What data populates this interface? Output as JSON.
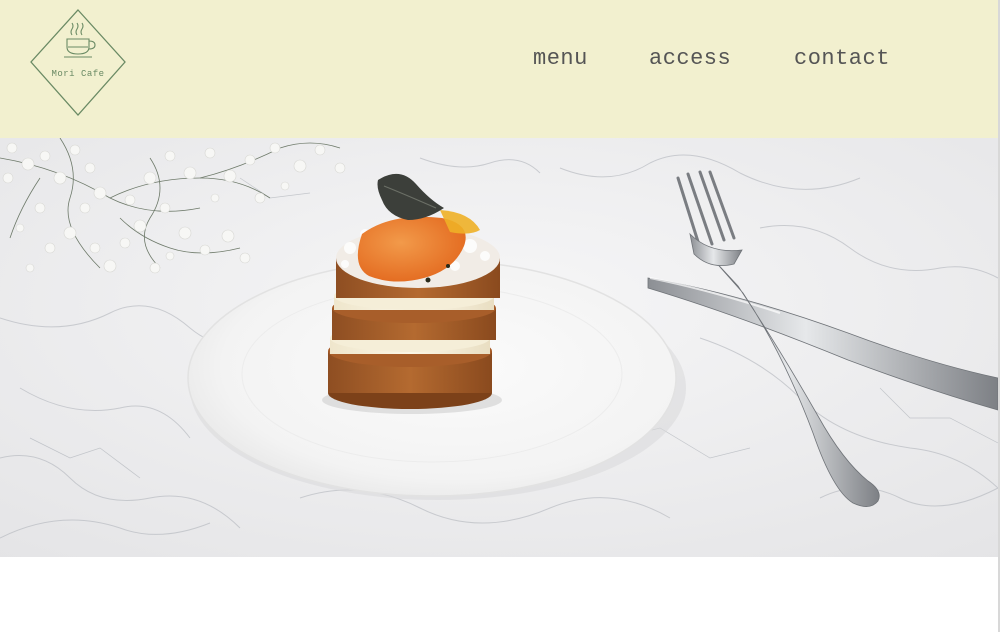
{
  "brand": {
    "name": "Mori Cafe",
    "logo_icon": "coffee-cup-icon",
    "logo_color": "#6a8a64"
  },
  "nav": {
    "items": [
      {
        "label": "menu"
      },
      {
        "label": "access"
      },
      {
        "label": "contact"
      }
    ]
  },
  "colors": {
    "header_bg": "#f2f0cf",
    "nav_text": "#555555"
  },
  "hero": {
    "image": "layered-cake-on-white-plate-with-fork-and-knife-on-marble"
  }
}
